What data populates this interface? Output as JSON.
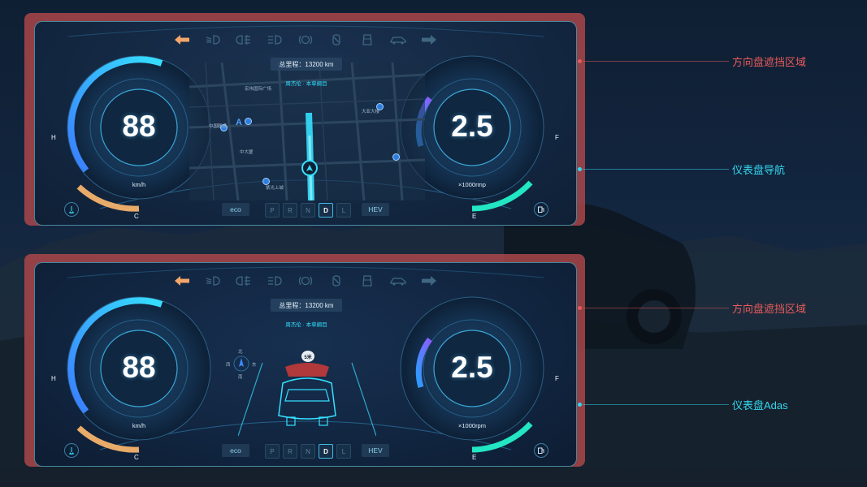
{
  "colors": {
    "accent_cyan": "#35e0ff",
    "mask_red": "#b0484a",
    "callout_red": "#e65a5a",
    "callout_cyan": "#34d6ee",
    "speed_arc": "#2fa8ff",
    "temp_arc": "#f5b36b",
    "rpm_arc": "#6a5cff",
    "fuel_arc": "#22e6c4",
    "turn_arrow_active": "#f6a66a"
  },
  "top_icons": [
    "left-turn-arrow-icon",
    "low-beam-icon",
    "fog-light-icon",
    "high-beam-icon",
    "brake-warning-icon",
    "seat-belt-icon",
    "door-open-icon",
    "car-body-icon",
    "right-turn-arrow-icon"
  ],
  "panels": [
    {
      "odometer": "总里程：13200 km",
      "nav_route": "周杰伦 · 本草纲目",
      "speed_value": "88",
      "speed_unit": "km/h",
      "rpm_value": "2.5",
      "rpm_unit": "×1000rmp",
      "temp_high": "H",
      "temp_low": "C",
      "fuel_full": "F",
      "fuel_empty": "E",
      "mode_left": "eco",
      "mode_right": "HEV",
      "gears": [
        "P",
        "R",
        "N",
        "D",
        "L"
      ],
      "active_gear": "D",
      "center_view": "map",
      "map_labels": [
        "中国联通",
        "中大厦",
        "大亚大楼",
        "宏伟国际广场",
        "紫光上城"
      ],
      "callout_mask": "方向盘遮挡区域",
      "callout_panel": "仪表盘导航"
    },
    {
      "odometer": "总里程：13200 km",
      "nav_route": "周杰伦 · 本草纲目",
      "speed_value": "88",
      "speed_unit": "km/h",
      "rpm_value": "2.5",
      "rpm_unit": "×1000rpm",
      "temp_high": "H",
      "temp_low": "C",
      "fuel_full": "F",
      "fuel_empty": "E",
      "mode_left": "eco",
      "mode_right": "HEV",
      "gears": [
        "P",
        "R",
        "N",
        "D",
        "L"
      ],
      "active_gear": "D",
      "center_view": "adas",
      "adas_distance": "5米",
      "compass": {
        "north": "北",
        "south": "南",
        "west": "西",
        "east": "东"
      },
      "callout_mask": "方向盘遮挡区域",
      "callout_panel": "仪表盘Adas"
    }
  ]
}
